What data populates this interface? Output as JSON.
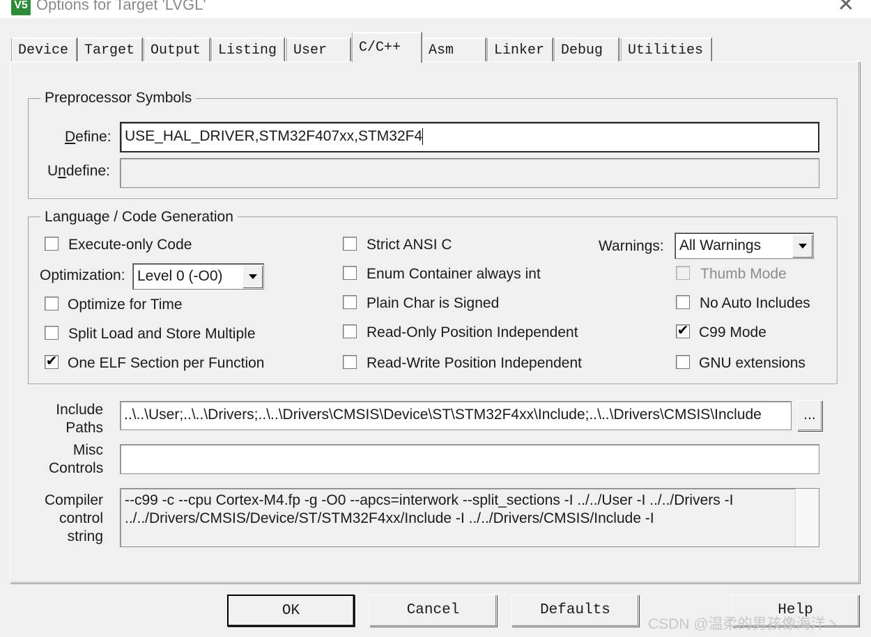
{
  "window": {
    "title": "Options for Target 'LVGL'",
    "icon": "V5",
    "close": "✕"
  },
  "tabs": [
    {
      "label": "Device"
    },
    {
      "label": "Target"
    },
    {
      "label": "Output"
    },
    {
      "label": "Listing"
    },
    {
      "label": "User"
    },
    {
      "label": "C/C++",
      "active": true
    },
    {
      "label": "Asm"
    },
    {
      "label": "Linker"
    },
    {
      "label": "Debug"
    },
    {
      "label": "Utilities"
    }
  ],
  "preprocessor": {
    "group_label": "Preprocessor Symbols",
    "define_label": "Define:",
    "define_value": "USE_HAL_DRIVER,STM32F407xx,STM32F4",
    "undefine_label": "Undefine:",
    "undefine_value": ""
  },
  "language": {
    "group_label": "Language / Code Generation",
    "execute_only": {
      "label": "Execute-only Code",
      "checked": false
    },
    "optimization_label": "Optimization:",
    "optimization_value": "Level 0 (-O0)",
    "optimize_time": {
      "label": "Optimize for Time",
      "checked": false
    },
    "split_load": {
      "label": "Split Load and Store Multiple",
      "checked": false
    },
    "one_elf": {
      "label": "One ELF Section per Function",
      "checked": true
    },
    "strict_ansi": {
      "label": "Strict ANSI C",
      "checked": false
    },
    "enum_container": {
      "label": "Enum Container always int",
      "checked": false
    },
    "plain_char": {
      "label": "Plain Char is Signed",
      "checked": false
    },
    "ro_pi": {
      "label": "Read-Only Position Independent",
      "checked": false
    },
    "rw_pi": {
      "label": "Read-Write Position Independent",
      "checked": false
    },
    "warnings_label": "Warnings:",
    "warnings_value": "All Warnings",
    "thumb_mode": {
      "label": "Thumb Mode",
      "checked": false,
      "disabled": true
    },
    "no_auto_includes": {
      "label": "No Auto Includes",
      "checked": false
    },
    "c99_mode": {
      "label": "C99 Mode",
      "checked": true
    },
    "gnu_ext": {
      "label": "GNU extensions",
      "checked": false
    }
  },
  "include": {
    "label_line1": "Include",
    "label_line2": "Paths",
    "value": "..\\..\\User;..\\..\\Drivers;..\\..\\Drivers\\CMSIS\\Device\\ST\\STM32F4xx\\Include;..\\..\\Drivers\\CMSIS\\Include",
    "browse": "..."
  },
  "misc": {
    "label_line1": "Misc",
    "label_line2": "Controls",
    "value": ""
  },
  "compiler": {
    "label_line1": "Compiler",
    "label_line2": "control",
    "label_line3": "string",
    "line1": "--c99 -c --cpu Cortex-M4.fp -g -O0 --apcs=interwork --split_sections -I ../../User -I ../../Drivers -I",
    "line2": "../../Drivers/CMSIS/Device/ST/STM32F4xx/Include -I ../../Drivers/CMSIS/Include -I"
  },
  "buttons": {
    "ok": "OK",
    "cancel": "Cancel",
    "defaults": "Defaults",
    "help": "Help"
  },
  "watermark": "CSDN @温柔的男孩像海洋丶"
}
